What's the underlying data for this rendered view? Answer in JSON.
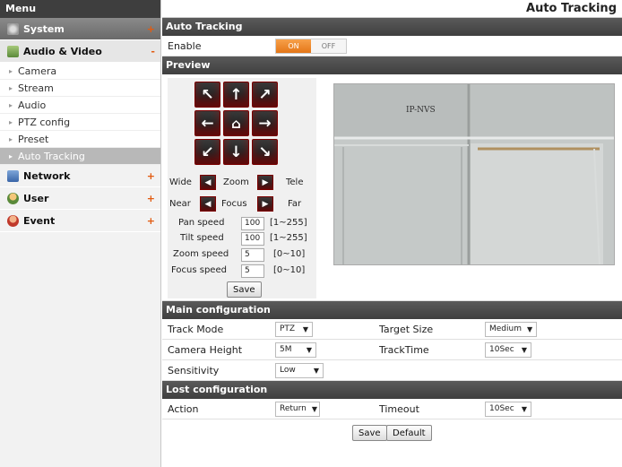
{
  "sidebar": {
    "header": "Menu",
    "categories": {
      "system": {
        "label": "System",
        "sign": "+"
      },
      "av": {
        "label": "Audio & Video",
        "sign": "-"
      },
      "network": {
        "label": "Network",
        "sign": "+"
      },
      "user": {
        "label": "User",
        "sign": "+"
      },
      "event": {
        "label": "Event",
        "sign": "+"
      }
    },
    "sub_items": [
      "Camera",
      "Stream",
      "Audio",
      "PTZ config",
      "Preset",
      "Auto Tracking"
    ]
  },
  "page": {
    "title": "Auto Tracking"
  },
  "auto_tracking": {
    "section": "Auto Tracking",
    "enable_label": "Enable",
    "on": "ON",
    "off": "OFF"
  },
  "preview": {
    "section": "Preview",
    "wide": "Wide",
    "zoom": "Zoom",
    "tele": "Tele",
    "near": "Near",
    "focus": "Focus",
    "far": "Far",
    "pan_speed_label": "Pan speed",
    "pan_speed": "100",
    "pan_range": "[1~255]",
    "tilt_speed_label": "Tilt speed",
    "tilt_speed": "100",
    "tilt_range": "[1~255]",
    "zoom_speed_label": "Zoom speed",
    "zoom_speed": "5",
    "zoom_range": "[0~10]",
    "focus_speed_label": "Focus speed",
    "focus_speed": "5",
    "focus_range": "[0~10]",
    "save": "Save",
    "video_text": "IP-NVS"
  },
  "main_config": {
    "section": "Main configuration",
    "track_mode_label": "Track Mode",
    "track_mode": "PTZ",
    "target_size_label": "Target Size",
    "target_size": "Medium",
    "camera_height_label": "Camera Height",
    "camera_height": "5M",
    "track_time_label": "TrackTime",
    "track_time": "10Sec",
    "sensitivity_label": "Sensitivity",
    "sensitivity": "Low"
  },
  "lost_config": {
    "section": "Lost configuration",
    "action_label": "Action",
    "action": "Return",
    "timeout_label": "Timeout",
    "timeout": "10Sec"
  },
  "footer": {
    "save": "Save",
    "default": "Default"
  },
  "colors": {
    "accent": "#e47617",
    "section": "#3f3f3f",
    "ptz_button": "#7a0000"
  }
}
